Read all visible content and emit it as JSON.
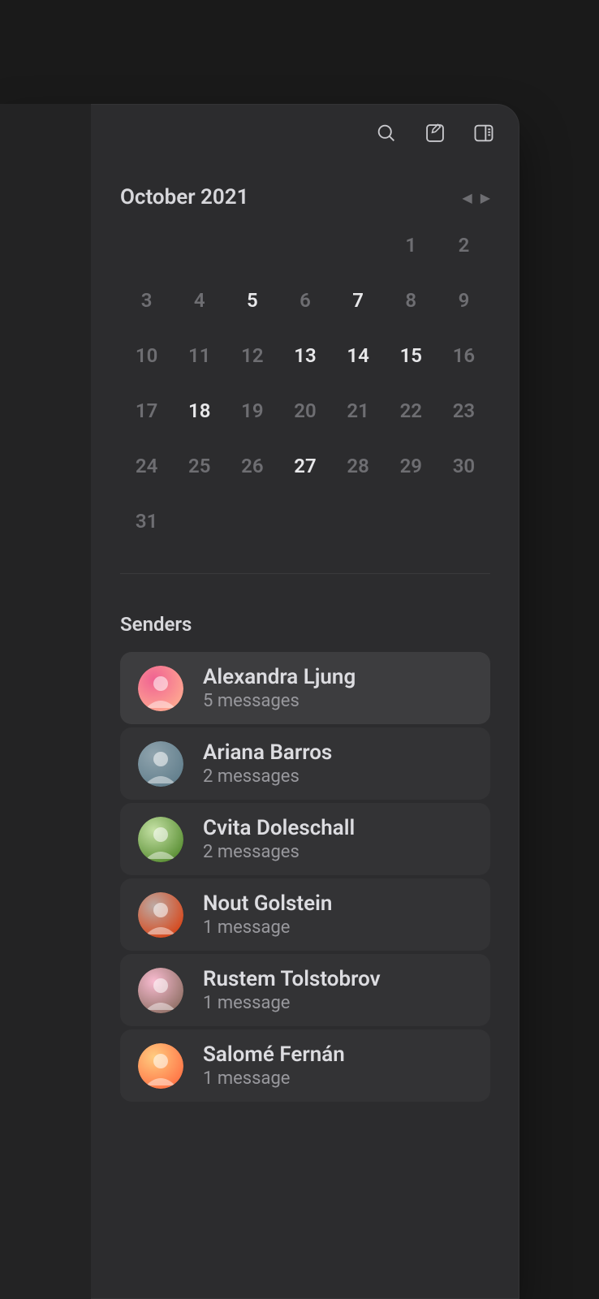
{
  "toolbar": {
    "search_icon": "search",
    "compose_icon": "compose",
    "panel_icon": "panel-toggle"
  },
  "calendar": {
    "title": "October 2021",
    "days": [
      {
        "n": "",
        "active": false
      },
      {
        "n": "",
        "active": false
      },
      {
        "n": "",
        "active": false
      },
      {
        "n": "",
        "active": false
      },
      {
        "n": "",
        "active": false
      },
      {
        "n": "1",
        "active": false
      },
      {
        "n": "2",
        "active": false
      },
      {
        "n": "3",
        "active": false
      },
      {
        "n": "4",
        "active": false
      },
      {
        "n": "5",
        "active": true
      },
      {
        "n": "6",
        "active": false
      },
      {
        "n": "7",
        "active": true
      },
      {
        "n": "8",
        "active": false
      },
      {
        "n": "9",
        "active": false
      },
      {
        "n": "10",
        "active": false
      },
      {
        "n": "11",
        "active": false
      },
      {
        "n": "12",
        "active": false
      },
      {
        "n": "13",
        "active": true
      },
      {
        "n": "14",
        "active": true
      },
      {
        "n": "15",
        "active": true
      },
      {
        "n": "16",
        "active": false
      },
      {
        "n": "17",
        "active": false
      },
      {
        "n": "18",
        "active": true
      },
      {
        "n": "19",
        "active": false
      },
      {
        "n": "20",
        "active": false
      },
      {
        "n": "21",
        "active": false
      },
      {
        "n": "22",
        "active": false
      },
      {
        "n": "23",
        "active": false
      },
      {
        "n": "24",
        "active": false
      },
      {
        "n": "25",
        "active": false
      },
      {
        "n": "26",
        "active": false
      },
      {
        "n": "27",
        "active": true
      },
      {
        "n": "28",
        "active": false
      },
      {
        "n": "29",
        "active": false
      },
      {
        "n": "30",
        "active": false
      },
      {
        "n": "31",
        "active": false
      }
    ]
  },
  "senders": {
    "title": "Senders",
    "items": [
      {
        "name": "Alexandra Ljung",
        "count": "5 messages",
        "selected": true,
        "avatar_colors": [
          "#f06292",
          "#ffab91"
        ]
      },
      {
        "name": "Ariana Barros",
        "count": "2 messages",
        "selected": false,
        "avatar_colors": [
          "#90a4ae",
          "#607d8b"
        ]
      },
      {
        "name": "Cvita Doleschall",
        "count": "2 messages",
        "selected": false,
        "avatar_colors": [
          "#c5e1a5",
          "#558b2f"
        ]
      },
      {
        "name": "Nout Golstein",
        "count": "1 message",
        "selected": false,
        "avatar_colors": [
          "#bcaaa4",
          "#d84315"
        ]
      },
      {
        "name": "Rustem Tolstobrov",
        "count": "1 message",
        "selected": false,
        "avatar_colors": [
          "#f8bbd0",
          "#8d6e63"
        ]
      },
      {
        "name": "Salomé Fernán",
        "count": "1 message",
        "selected": false,
        "avatar_colors": [
          "#ffcc80",
          "#ff7043"
        ]
      }
    ]
  }
}
